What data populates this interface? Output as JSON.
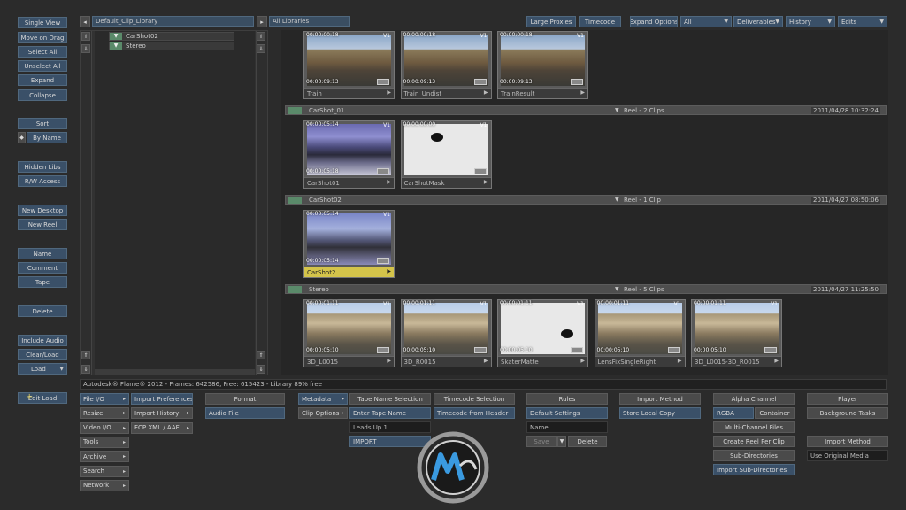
{
  "left_tools": [
    "Single View",
    "Move on Drag",
    "Select All",
    "Unselect All",
    "Expand",
    "Collapse"
  ],
  "sort": {
    "label": "Sort",
    "by": "By Name"
  },
  "access": [
    "Hidden Libs",
    "R/W Access"
  ],
  "desk": [
    "New Desktop",
    "New Reel"
  ],
  "fields": [
    "Name",
    "Comment",
    "Tape"
  ],
  "delete_label": "Delete",
  "include_audio": "Include Audio",
  "clear_load": "Clear/Load",
  "load": "Load",
  "edit_load": "Edit Load",
  "library_name": "Default_Clip_Library",
  "tree": [
    {
      "label": "CarShot02"
    },
    {
      "label": "Stereo"
    }
  ],
  "all_libraries": "All Libraries",
  "topbar": {
    "large_proxies": "Large Proxies",
    "timecode": "Timecode",
    "expand_options": "Expand Options",
    "filter_all": "All",
    "deliverables": "Deliverables",
    "history": "History",
    "edits": "Edits"
  },
  "reels": [
    {
      "name": "",
      "summary": "",
      "date": "",
      "clips": [
        {
          "name": "Train",
          "tc_in": "00:00:00:18",
          "tc_out": "00:00:09:13",
          "track": "V1",
          "type": "street"
        },
        {
          "name": "Train_Undist",
          "tc_in": "00:00:00:18",
          "tc_out": "00:00:09:13",
          "track": "V1",
          "type": "street"
        },
        {
          "name": "TrainResult",
          "tc_in": "00:00:00:18",
          "tc_out": "00:00:09:13",
          "track": "V1",
          "type": "street"
        }
      ]
    },
    {
      "name": "CarShot_01",
      "summary": "Reel - 2 Clips",
      "date": "2011/04/28 10:32:24",
      "clips": [
        {
          "name": "CarShot01",
          "tc_in": "00:00:05:14",
          "tc_out": "00:00:05:18",
          "track": "V1",
          "type": "car"
        },
        {
          "name": "CarShotMask",
          "tc_in": "00:00:00:00",
          "tc_out": "",
          "track": "V1",
          "type": "mask"
        }
      ]
    },
    {
      "name": "CarShot02",
      "summary": "Reel - 1 Clip",
      "date": "2011/04/27 08:50:06",
      "clips": [
        {
          "name": "CarShot2",
          "tc_in": "00:00:05:14",
          "tc_out": "00:00:05:14",
          "track": "V1",
          "type": "car2",
          "selected": true
        }
      ]
    },
    {
      "name": "Stereo",
      "summary": "Reel - 5 Clips",
      "date": "2011/04/27 11:25:50",
      "clips": [
        {
          "name": "3D_L0015",
          "tc_in": "00:00:01:11",
          "tc_out": "00:00:05:10",
          "track": "V1",
          "type": "bld"
        },
        {
          "name": "3D_R0015",
          "tc_in": "00:00:01:11",
          "tc_out": "00:00:05:10",
          "track": "V1",
          "type": "bld"
        },
        {
          "name": "SkaterMatte",
          "tc_in": "00:00:01:11",
          "tc_out": "00:00:05:10",
          "track": "V1",
          "type": "mask"
        },
        {
          "name": "LensFixSingleRight",
          "tc_in": "00:00:01:11",
          "tc_out": "00:00:05:10",
          "track": "V1",
          "type": "bld"
        },
        {
          "name": "3D_L0015-3D_R0015",
          "tc_in": "00:00:01:11",
          "tc_out": "00:00:05:10",
          "track": "V1",
          "type": "bld"
        }
      ]
    }
  ],
  "status": "Autodesk® Flame® 2012  -  Frames: 642586, Free: 615423  -  Library 89% free",
  "bottom": {
    "col1": [
      "File I/O",
      "Resize",
      "Video I/O",
      "Tools",
      "Archive",
      "Search",
      "Network"
    ],
    "col2": [
      "Import Preferences",
      "Import History",
      "FCP XML / AAF"
    ],
    "format_header": "Format",
    "format_value": "Audio File",
    "metadata": "Metadata",
    "clip_options": "Clip Options",
    "tape_header": "Tape Name Selection",
    "tape_value": "Enter Tape Name",
    "tape_input": "Leads Up 1",
    "import_label": "IMPORT",
    "tc_header": "Timecode Selection",
    "tc_value": "Timecode from Header",
    "rules_header": "Rules",
    "rules_value": "Default Settings",
    "name_placeholder": "Name",
    "save": "Save",
    "delete": "Delete",
    "im_header": "Import Method",
    "im_value": "Store Local Copy",
    "alpha_header": "Alpha Channel",
    "rgba": "RGBA",
    "container": "Container",
    "multi": "Multi-Channel Files",
    "create_reel": "Create Reel Per Clip",
    "subdirs": "Sub-Directories",
    "import_subdirs": "Import Sub-Directories",
    "player": "Player",
    "bg_tasks": "Background Tasks",
    "import_method2": "Import Method",
    "use_original": "Use Original Media"
  },
  "colors": {
    "accent_blue": "#3a5068",
    "selected_yellow": "#d4c44a",
    "reel_toggle": "#5a8a6a"
  }
}
